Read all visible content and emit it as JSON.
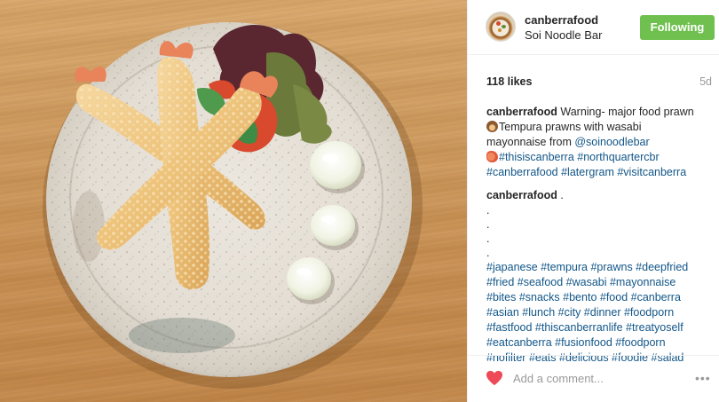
{
  "post": {
    "username": "canberrafood",
    "location": "Soi Noodle Bar",
    "follow_label": "Following",
    "likes": "118 likes",
    "age": "5d",
    "photo_label": "photo"
  },
  "caption": {
    "user": "canberrafood",
    "line1": "Warning- major food prawn",
    "line2": "Tempura prawns with wasabi",
    "line3_text": "mayonnaise from ",
    "line3_tag": "@soinoodlebar",
    "line4_tag1": "#thisiscanberra",
    "line4_tag2": "#northquartercbr",
    "line5_tag1": "#canberrafood",
    "line5_tag2": "#latergram",
    "line5_tag3": "#visitcanberra"
  },
  "second_comment": {
    "user": "canberrafood",
    "text": ".",
    "dots": [
      ".",
      ".",
      ".",
      "."
    ],
    "hashtag_lines": [
      "#japanese #tempura #prawns #deepfried",
      "#fried #seafood #wasabi #mayonnaise",
      "#bites #snacks #bento #food #canberra",
      "#asian #lunch #city #dinner #foodporn",
      "#fastfood #thiscanberranlife #treatyoself",
      "#eatcanberra #fusionfood #foodporn",
      "#nofilter #eats #delicious #foodie #salad"
    ]
  },
  "footer": {
    "comment_placeholder": "Add a comment...",
    "more_label": "•••"
  },
  "colors": {
    "follow_green": "#70c050",
    "hashtag_blue": "#125688",
    "heart_red": "#ed4956"
  },
  "icons": [
    "heart-icon",
    "more-options-icon",
    "avatar"
  ]
}
